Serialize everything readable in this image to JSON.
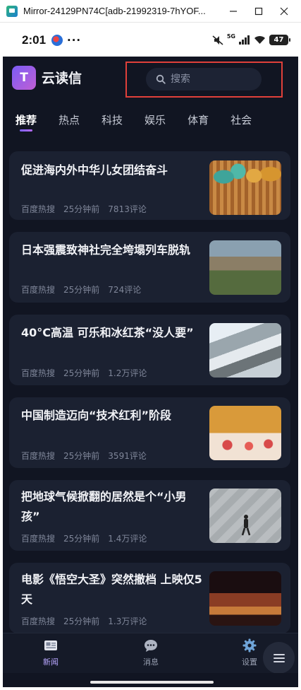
{
  "window": {
    "title": "Mirror-24129PN74C[adb-21992319-7hYOF...",
    "minimize_icon": "minimize-icon",
    "maximize_icon": "maximize-icon",
    "close_icon": "close-icon"
  },
  "status_bar": {
    "time": "2:01",
    "dots": "···",
    "network": "5G",
    "battery": "47"
  },
  "header": {
    "logo_letter": "T",
    "app_name": "云读信",
    "search_placeholder": "搜索"
  },
  "tabs": [
    {
      "label": "推荐",
      "active": true
    },
    {
      "label": "热点",
      "active": false
    },
    {
      "label": "科技",
      "active": false
    },
    {
      "label": "娱乐",
      "active": false
    },
    {
      "label": "体育",
      "active": false
    },
    {
      "label": "社会",
      "active": false
    }
  ],
  "news": [
    {
      "title": "促进海内外中华儿女团结奋斗",
      "source": "百度热搜",
      "time": "25分钟前",
      "comments": "7813评论"
    },
    {
      "title": "日本强震致神社完全垮塌列车脱轨",
      "source": "百度热搜",
      "time": "25分钟前",
      "comments": "724评论"
    },
    {
      "title": "40°C高温 可乐和冰红茶“没人要”",
      "source": "百度热搜",
      "time": "25分钟前",
      "comments": "1.2万评论"
    },
    {
      "title": "中国制造迈向“技术红利”阶段",
      "source": "百度热搜",
      "time": "25分钟前",
      "comments": "3591评论"
    },
    {
      "title": "把地球气候掀翻的居然是个“小男孩”",
      "source": "百度热搜",
      "time": "25分钟前",
      "comments": "1.4万评论"
    },
    {
      "title": "电影《悟空大圣》突然撤档 上映仅5天",
      "source": "百度热搜",
      "time": "25分钟前",
      "comments": "1.3万评论"
    }
  ],
  "bottom_nav": [
    {
      "label": "新闻",
      "icon": "newspaper-icon",
      "active": true
    },
    {
      "label": "消息",
      "icon": "chat-bubble-icon",
      "active": false
    },
    {
      "label": "设置",
      "icon": "gear-icon",
      "active": false
    }
  ],
  "colors": {
    "background": "#111522",
    "card": "#1b2131",
    "accent": "#8b6cff",
    "highlight_border": "#e0403a"
  }
}
